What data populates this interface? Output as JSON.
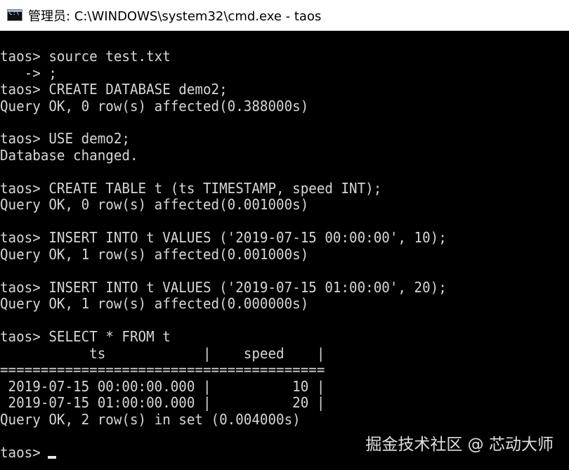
{
  "window": {
    "title_prefix": "管理员: ",
    "title_main": "C:\\WINDOWS\\system32\\cmd.exe - taos",
    "icon": "cmd-icon",
    "icon_label": "C:\\"
  },
  "console": {
    "lines": [
      "taos> source test.txt",
      "   -> ;",
      "taos> CREATE DATABASE demo2;",
      "Query OK, 0 row(s) affected(0.388000s)",
      "",
      "taos> USE demo2;",
      "Database changed.",
      "",
      "taos> CREATE TABLE t (ts TIMESTAMP, speed INT);",
      "Query OK, 0 row(s) affected(0.001000s)",
      "",
      "taos> INSERT INTO t VALUES ('2019-07-15 00:00:00', 10);",
      "Query OK, 1 row(s) affected(0.001000s)",
      "",
      "taos> INSERT INTO t VALUES ('2019-07-15 01:00:00', 20);",
      "Query OK, 1 row(s) affected(0.000000s)",
      "",
      "taos> SELECT * FROM t",
      "           ts            |    speed    |",
      "========================================",
      " 2019-07-15 00:00:00.000 |          10 |",
      " 2019-07-15 01:00:00.000 |          20 |",
      "Query OK, 2 row(s) in set (0.004000s)",
      "",
      "taos> "
    ],
    "cursor": "block-cursor"
  },
  "watermark": {
    "text": "掘金技术社区 @ 芯动大师"
  }
}
